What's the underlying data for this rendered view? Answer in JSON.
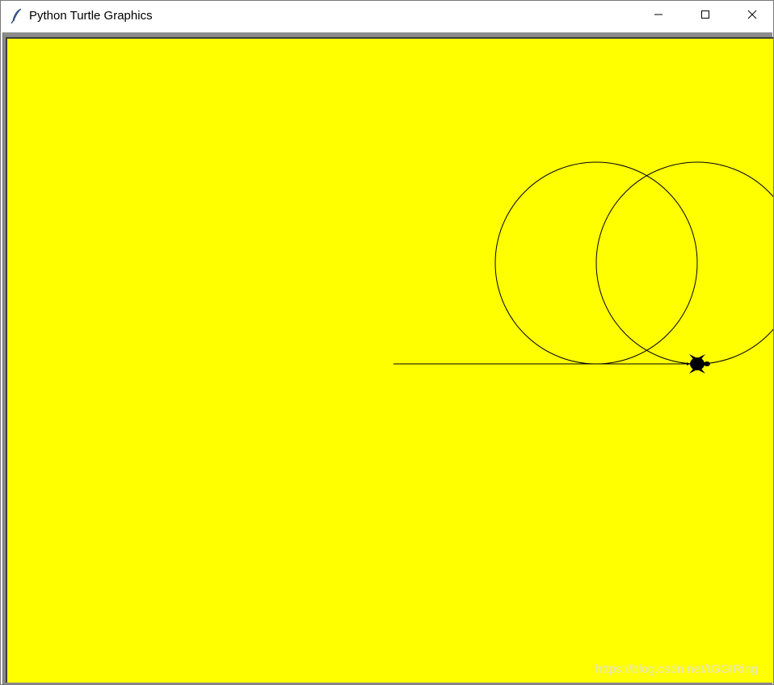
{
  "window": {
    "title": "Python Turtle Graphics"
  },
  "icons": {
    "app": "feather-icon",
    "minimize": "minimize-icon",
    "maximize": "maximize-icon",
    "close": "close-icon",
    "turtle": "turtle-cursor-icon"
  },
  "canvas": {
    "background_color": "#ffff00",
    "pen_color": "#000000"
  },
  "watermark": {
    "text": "https://blog.csdn.net/IGGIRing"
  }
}
